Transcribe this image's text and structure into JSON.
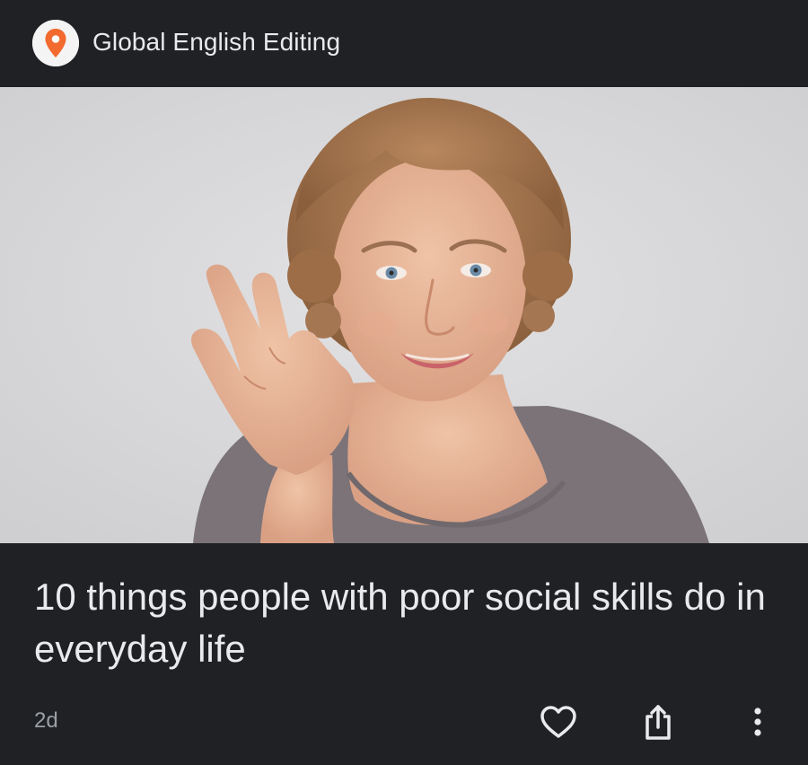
{
  "publisher": {
    "name": "Global English Editing",
    "logo_icon": "map-pin-icon",
    "logo_color": "#f26a2e"
  },
  "article": {
    "title": "10 things people with poor social skills do in everyday life",
    "age": "2d",
    "image_subject": "woman-waving-hand-photo"
  },
  "actions": {
    "like_icon": "heart-outline-icon",
    "share_icon": "share-icon",
    "more_icon": "more-vert-icon"
  },
  "colors": {
    "background": "#202124",
    "text_primary": "#e8eaed",
    "text_secondary": "#9aa0a6"
  }
}
